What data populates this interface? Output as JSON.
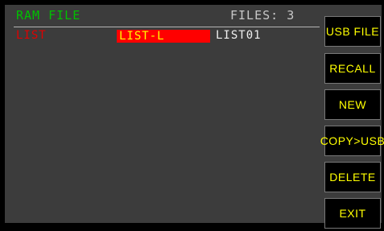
{
  "colors": {
    "title": "#00c000",
    "list_label": "#e00000",
    "selected_text": "#ffff00",
    "softkey_text": "#ffff00"
  },
  "header": {
    "title": "RAM FILE",
    "file_count": "FILES: 3"
  },
  "file_row": {
    "label": "LIST",
    "selected_file": "LIST-L",
    "other_file": "LIST01"
  },
  "softkeys": [
    {
      "label": "USB FILE"
    },
    {
      "label": "RECALL"
    },
    {
      "label": "NEW"
    },
    {
      "label": "COPY>USB"
    },
    {
      "label": "DELETE"
    },
    {
      "label": "EXIT"
    }
  ]
}
